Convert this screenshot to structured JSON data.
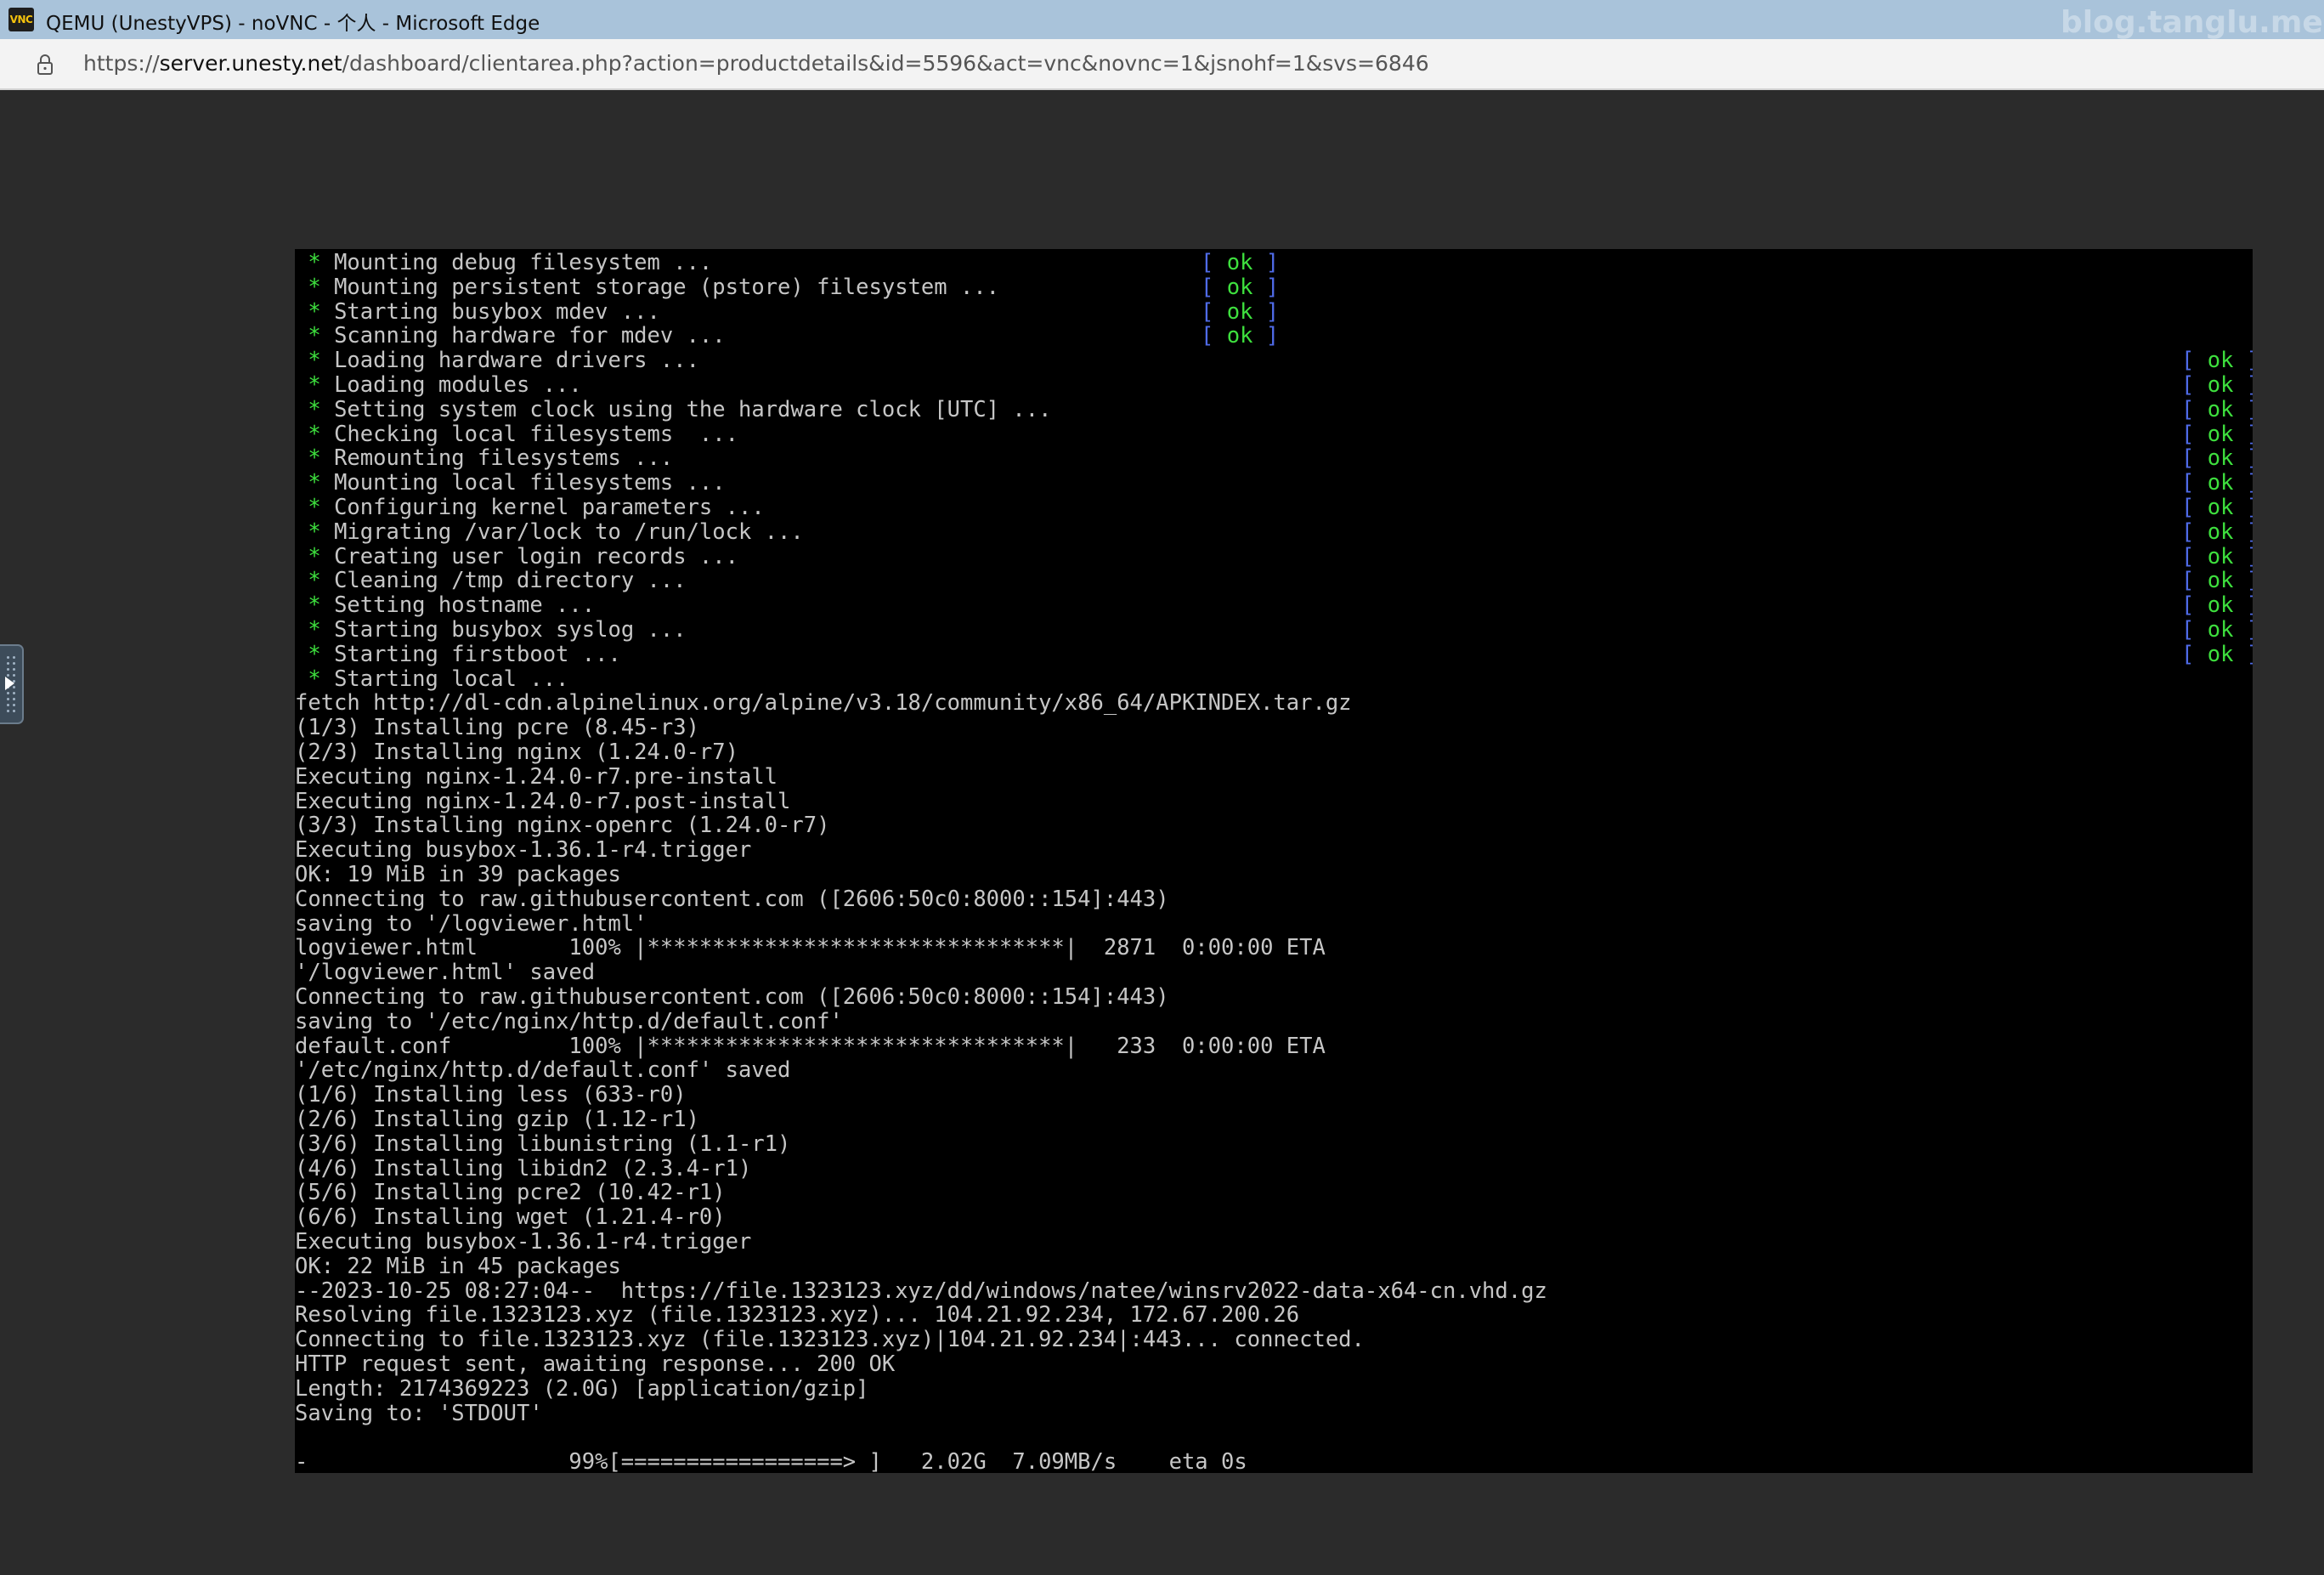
{
  "window": {
    "title": "QEMU (UnestyVPS) - noVNC - 个人 - Microsoft Edge",
    "logo_text": "VNC",
    "watermark": "blog.tanglu.me"
  },
  "address_bar": {
    "scheme": "https://",
    "host": "server.unesty.net",
    "path": "/dashboard/clientarea.php?action=productdetails&id=5596&act=vnc&novnc=1&jsnohf=1&svs=6846"
  },
  "colors": {
    "ok_green": "#3ee03e",
    "bracket_blue": "#4f6be8",
    "terminal_text": "#c6c6c6",
    "terminal_bg": "#000000"
  },
  "terminal": {
    "ok_label": "ok",
    "services_short": [
      "Mounting debug filesystem ...",
      "Mounting persistent storage (pstore) filesystem ...",
      "Starting busybox mdev ...",
      "Scanning hardware for mdev ..."
    ],
    "services_long": [
      "Loading hardware drivers ...",
      "Loading modules ...",
      "Setting system clock using the hardware clock [UTC] ...",
      "Checking local filesystems  ...",
      "Remounting filesystems ...",
      "Mounting local filesystems ...",
      "Configuring kernel parameters ...",
      "Migrating /var/lock to /run/lock ...",
      "Creating user login records ...",
      "Cleaning /tmp directory ...",
      "Setting hostname ...",
      "Starting busybox syslog ...",
      "Starting firstboot ..."
    ],
    "service_pending": "Starting local ...",
    "output_lines": [
      "fetch http://dl-cdn.alpinelinux.org/alpine/v3.18/community/x86_64/APKINDEX.tar.gz",
      "(1/3) Installing pcre (8.45-r3)",
      "(2/3) Installing nginx (1.24.0-r7)",
      "Executing nginx-1.24.0-r7.pre-install",
      "Executing nginx-1.24.0-r7.post-install",
      "(3/3) Installing nginx-openrc (1.24.0-r7)",
      "Executing busybox-1.36.1-r4.trigger",
      "OK: 19 MiB in 39 packages",
      "Connecting to raw.githubusercontent.com ([2606:50c0:8000::154]:443)",
      "saving to '/logviewer.html'",
      "logviewer.html       100% |********************************|  2871  0:00:00 ETA",
      "'/logviewer.html' saved",
      "Connecting to raw.githubusercontent.com ([2606:50c0:8000::154]:443)",
      "saving to '/etc/nginx/http.d/default.conf'",
      "default.conf         100% |********************************|   233  0:00:00 ETA",
      "'/etc/nginx/http.d/default.conf' saved",
      "(1/6) Installing less (633-r0)",
      "(2/6) Installing gzip (1.12-r1)",
      "(3/6) Installing libunistring (1.1-r1)",
      "(4/6) Installing libidn2 (2.3.4-r1)",
      "(5/6) Installing pcre2 (10.42-r1)",
      "(6/6) Installing wget (1.21.4-r0)",
      "Executing busybox-1.36.1-r4.trigger",
      "OK: 22 MiB in 45 packages",
      "--2023-10-25 08:27:04--  https://file.1323123.xyz/dd/windows/natee/winsrv2022-data-x64-cn.vhd.gz",
      "Resolving file.1323123.xyz (file.1323123.xyz)... 104.21.92.234, 172.67.200.26",
      "Connecting to file.1323123.xyz (file.1323123.xyz)|104.21.92.234|:443... connected.",
      "HTTP request sent, awaiting response... 200 OK",
      "Length: 2174369223 (2.0G) [application/gzip]",
      "Saving to: 'STDOUT'",
      "",
      "-                    99%[=================> ]   2.02G  7.09MB/s    eta 0s"
    ]
  }
}
